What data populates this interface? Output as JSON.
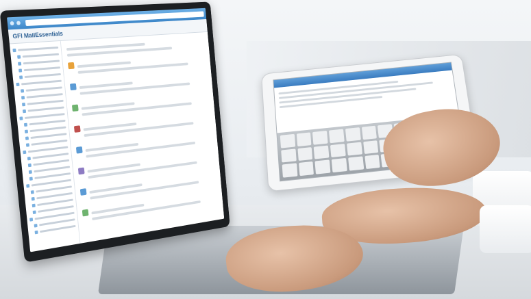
{
  "screen": {
    "app_title": "GFI MailEssentials",
    "app_title_suffix": "",
    "accent_color": "#3c86c8",
    "sidebar_rows": 28,
    "content_blocks": 8
  },
  "tablet": {
    "accent_color": "#3a7cc0",
    "keyboard_keys": 33
  }
}
